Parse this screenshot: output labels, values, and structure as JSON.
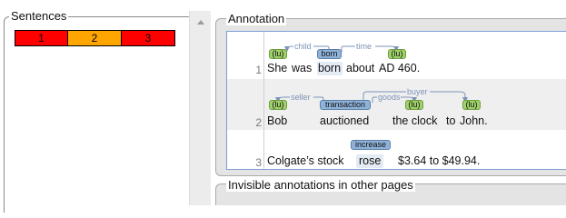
{
  "sentences_panel": {
    "title": "Sentences",
    "items": [
      {
        "label": "1",
        "color": "#ff0000"
      },
      {
        "label": "2",
        "color": "#ffa500"
      },
      {
        "label": "3",
        "color": "#ff0000"
      }
    ]
  },
  "annotation_panel": {
    "title": "Annotation",
    "lines": [
      {
        "number": "1",
        "tokens": [
          "She",
          "was",
          "born",
          "about",
          "AD 460."
        ],
        "spans": [
          "(lu)",
          "born",
          "(lu)"
        ],
        "arcs": [
          "child",
          "time"
        ]
      },
      {
        "number": "2",
        "tokens": [
          "Bob",
          "auctioned",
          "the clock",
          "to",
          "John."
        ],
        "spans": [
          "(lu)",
          "transaction",
          "(lu)",
          "(lu)"
        ],
        "arcs": [
          "seller",
          "goods",
          "buyer"
        ]
      },
      {
        "number": "3",
        "tokens": [
          "Colgate’s stock",
          "rose",
          "$3.64 to $49.94."
        ],
        "spans": [
          "increase"
        ],
        "arcs": []
      }
    ]
  },
  "invisible_panel": {
    "title": "Invisible annotations in other pages"
  },
  "colors": {
    "lu_box": "#9fd16a",
    "frame_box": "#8fb2d9",
    "arc": "#7b93b8",
    "doc_border": "#7f9fd8"
  },
  "icons": {
    "scroll_up": "triangle-up-icon"
  }
}
